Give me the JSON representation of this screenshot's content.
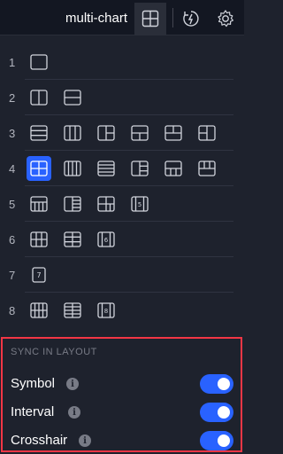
{
  "toolbar": {
    "title": "multi-chart",
    "layout_icon": "layout-grid-icon",
    "replay_icon": "replay-icon",
    "settings_icon": "gear-icon"
  },
  "layout_menu": {
    "rows": [
      {
        "count": "1",
        "options": [
          "single"
        ]
      },
      {
        "count": "2",
        "options": [
          "2-vertical",
          "2-horizontal"
        ]
      },
      {
        "count": "3",
        "options": [
          "3-rows",
          "3-columns",
          "1-left-2-right",
          "1-top-2-bottom",
          "2-top-1-bottom",
          "2-left-1-right"
        ]
      },
      {
        "count": "4",
        "options": [
          "2x2-grid",
          "4-columns",
          "4-rows",
          "1-left-3-right",
          "1-top-3-bottom",
          "3-top-1-bottom"
        ],
        "selected": "2x2-grid"
      },
      {
        "count": "5",
        "options": [
          "5-layout-a",
          "5-layout-b",
          "5-layout-c",
          "5-layout-d"
        ]
      },
      {
        "count": "6",
        "options": [
          "6-grid-3x2",
          "6-grid-2x3",
          "6-columns"
        ]
      },
      {
        "count": "7",
        "options": [
          "7-layout"
        ]
      },
      {
        "count": "8",
        "options": [
          "8-grid-4x2",
          "8-rows",
          "8-columns"
        ]
      }
    ],
    "badge_5": "5",
    "badge_6": "6",
    "badge_7": "7",
    "badge_8": "8"
  },
  "sync": {
    "title": "SYNC IN LAYOUT",
    "items": [
      {
        "label": "Symbol",
        "enabled": true
      },
      {
        "label": "Interval",
        "enabled": true
      },
      {
        "label": "Crosshair",
        "enabled": true
      }
    ],
    "info_glyph": "i"
  },
  "colors": {
    "accent": "#2962ff",
    "highlight_border": "#f23645",
    "background": "#1e222d"
  }
}
